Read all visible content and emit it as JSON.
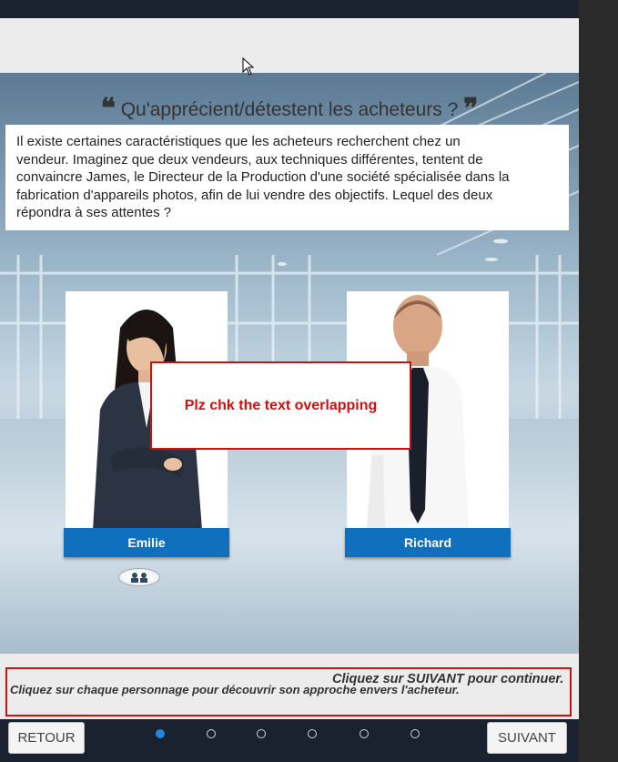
{
  "header": {
    "title_prefix_quote": "❝",
    "title": "Qu'apprécient/détestent les acheteurs ?",
    "title_suffix_quote": "❞"
  },
  "intro": {
    "lines": [
      "Il existe certaines caractéristiques que les acheteurs recherchent chez un",
      "vendeur. Imaginez que deux vendeurs, aux techniques différentes, tentent de",
      "convaincre James, le Directeur de la Production d'une société spécialisée dans la",
      "fabrication d'appareils photos, afin de lui vendre des objectifs. Lequel des deux",
      "répondra à ses attentes ?"
    ]
  },
  "characters": [
    {
      "name": "Emilie"
    },
    {
      "name": "Richard"
    }
  ],
  "review_note": "Plz chk the text overlapping",
  "footer": {
    "continue_msg": "Cliquez sur SUIVANT pour continuer.",
    "instruction_msg": "Cliquez sur chaque personnage pour découvrir son approche envers l'acheteur."
  },
  "nav": {
    "back_label": "RETOUR",
    "next_label": "SUIVANT",
    "page_count": 6,
    "current_page": 1
  },
  "colors": {
    "accent": "#1170bd",
    "review_red": "#cc1111",
    "dot_active": "#1f86e0"
  }
}
